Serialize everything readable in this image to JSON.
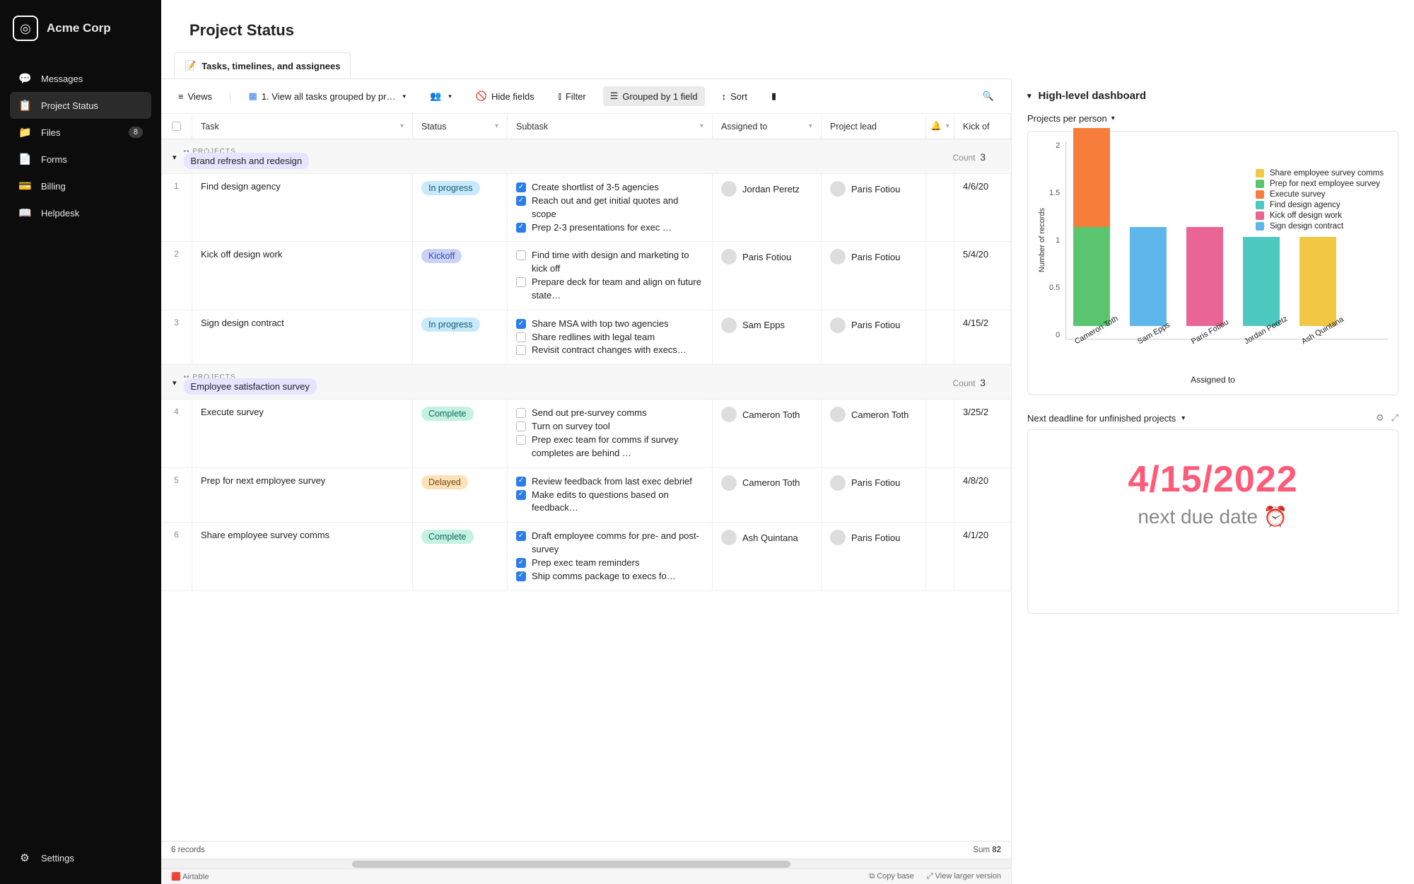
{
  "brand": {
    "name": "Acme Corp"
  },
  "nav": {
    "items": [
      {
        "label": "Messages",
        "icon": "💬"
      },
      {
        "label": "Project Status",
        "icon": "📋",
        "active": true
      },
      {
        "label": "Files",
        "icon": "📁",
        "badge": "8"
      },
      {
        "label": "Forms",
        "icon": "📄"
      },
      {
        "label": "Billing",
        "icon": "💳"
      },
      {
        "label": "Helpdesk",
        "icon": "📖"
      }
    ],
    "settings": "Settings"
  },
  "page": {
    "title": "Project Status"
  },
  "subtab": {
    "icon": "📝",
    "label": "Tasks, timelines, and assignees"
  },
  "toolbar": {
    "views": "Views",
    "viewName": "1. View all tasks grouped by pr…",
    "hideFields": "Hide fields",
    "filter": "Filter",
    "groupedBy": "Grouped by 1 field",
    "sort": "Sort"
  },
  "columns": {
    "task": "Task",
    "status": "Status",
    "subtask": "Subtask",
    "assignedTo": "Assigned to",
    "projectLead": "Project lead",
    "kickOff": "Kick of"
  },
  "groups": [
    {
      "label": "PROJECTS",
      "name": "Brand refresh and redesign",
      "countLabel": "Count",
      "count": "3",
      "rows": [
        {
          "num": "1",
          "task": "Find design agency",
          "status": "In progress",
          "statusClass": "s-progress",
          "subtasks": [
            {
              "done": true,
              "t": "Create shortlist of 3-5 agencies"
            },
            {
              "done": true,
              "t": "Reach out and get initial quotes and scope"
            },
            {
              "done": true,
              "t": "Prep 2-3 presentations for exec …"
            }
          ],
          "assigned": "Jordan Peretz",
          "lead": "Paris Fotiou",
          "date": "4/6/20"
        },
        {
          "num": "2",
          "task": "Kick off design work",
          "status": "Kickoff",
          "statusClass": "s-kickoff",
          "subtasks": [
            {
              "done": false,
              "t": "Find time with design and marketing to kick off"
            },
            {
              "done": false,
              "t": "Prepare deck for team and align on future state…"
            }
          ],
          "assigned": "Paris Fotiou",
          "lead": "Paris Fotiou",
          "date": "5/4/20"
        },
        {
          "num": "3",
          "task": "Sign design contract",
          "status": "In progress",
          "statusClass": "s-progress",
          "subtasks": [
            {
              "done": true,
              "t": "Share MSA with top two agencies"
            },
            {
              "done": false,
              "t": "Share redlines with legal team"
            },
            {
              "done": false,
              "t": "Revisit contract changes with execs…"
            }
          ],
          "assigned": "Sam Epps",
          "lead": "Paris Fotiou",
          "date": "4/15/2"
        }
      ]
    },
    {
      "label": "PROJECTS",
      "name": "Employee satisfaction survey",
      "countLabel": "Count",
      "count": "3",
      "rows": [
        {
          "num": "4",
          "task": "Execute survey",
          "status": "Complete",
          "statusClass": "s-complete",
          "subtasks": [
            {
              "done": false,
              "t": "Send out pre-survey comms"
            },
            {
              "done": false,
              "t": "Turn on survey tool"
            },
            {
              "done": false,
              "t": "Prep exec team for comms if survey completes are behind …"
            }
          ],
          "assigned": "Cameron Toth",
          "lead": "Cameron Toth",
          "date": "3/25/2"
        },
        {
          "num": "5",
          "task": "Prep for next employee survey",
          "status": "Delayed",
          "statusClass": "s-delayed",
          "subtasks": [
            {
              "done": true,
              "t": "Review feedback from last exec debrief"
            },
            {
              "done": true,
              "t": "Make edits to questions based on feedback…"
            }
          ],
          "assigned": "Cameron Toth",
          "lead": "Paris Fotiou",
          "date": "4/8/20"
        },
        {
          "num": "6",
          "task": "Share employee survey comms",
          "status": "Complete",
          "statusClass": "s-complete",
          "subtasks": [
            {
              "done": true,
              "t": "Draft employee comms for pre- and post-survey"
            },
            {
              "done": true,
              "t": "Prep exec team reminders"
            },
            {
              "done": true,
              "t": "Ship comms package to execs fo…"
            }
          ],
          "assigned": "Ash Quintana",
          "lead": "Paris Fotiou",
          "date": "4/1/20"
        }
      ]
    }
  ],
  "footer": {
    "records": "6 records",
    "sumLabel": "Sum",
    "sumValue": "82"
  },
  "bottom": {
    "brand": "Airtable",
    "copy": "Copy base",
    "enlarge": "View larger version"
  },
  "dashboard": {
    "title": "High-level dashboard",
    "chartTitle": "Projects per person",
    "deadlineTitle": "Next deadline for unfinished projects",
    "deadlineDate": "4/15/2022",
    "deadlineLabel": "next due date ⏰"
  },
  "chart_data": {
    "type": "bar",
    "stacked": true,
    "xlabel": "Assigned to",
    "ylabel": "Number of records",
    "ylim": [
      0,
      2
    ],
    "yticks": [
      0,
      0.5,
      1,
      1.5,
      2
    ],
    "categories": [
      "Cameron Toth",
      "Sam Epps",
      "Paris Fotiou",
      "Jordan Peretz",
      "Ash Quintana"
    ],
    "legend": [
      {
        "name": "Share employee survey comms",
        "color": "#f2c744"
      },
      {
        "name": "Prep for next employee survey",
        "color": "#59c66f"
      },
      {
        "name": "Execute survey",
        "color": "#f77e3a"
      },
      {
        "name": "Find design agency",
        "color": "#4ec9c0"
      },
      {
        "name": "Kick off design work",
        "color": "#e96594"
      },
      {
        "name": "Sign design contract",
        "color": "#5eb6ea"
      }
    ],
    "stacks": [
      [
        {
          "series": "Prep for next employee survey",
          "value": 1,
          "color": "#59c66f"
        },
        {
          "series": "Execute survey",
          "value": 1,
          "color": "#f77e3a"
        }
      ],
      [
        {
          "series": "Sign design contract",
          "value": 1,
          "color": "#5eb6ea"
        }
      ],
      [
        {
          "series": "Kick off design work",
          "value": 1,
          "color": "#e96594"
        }
      ],
      [
        {
          "series": "Find design agency",
          "value": 0.9,
          "color": "#4ec9c0"
        }
      ],
      [
        {
          "series": "Share employee survey comms",
          "value": 0.9,
          "color": "#f2c744"
        }
      ]
    ]
  }
}
